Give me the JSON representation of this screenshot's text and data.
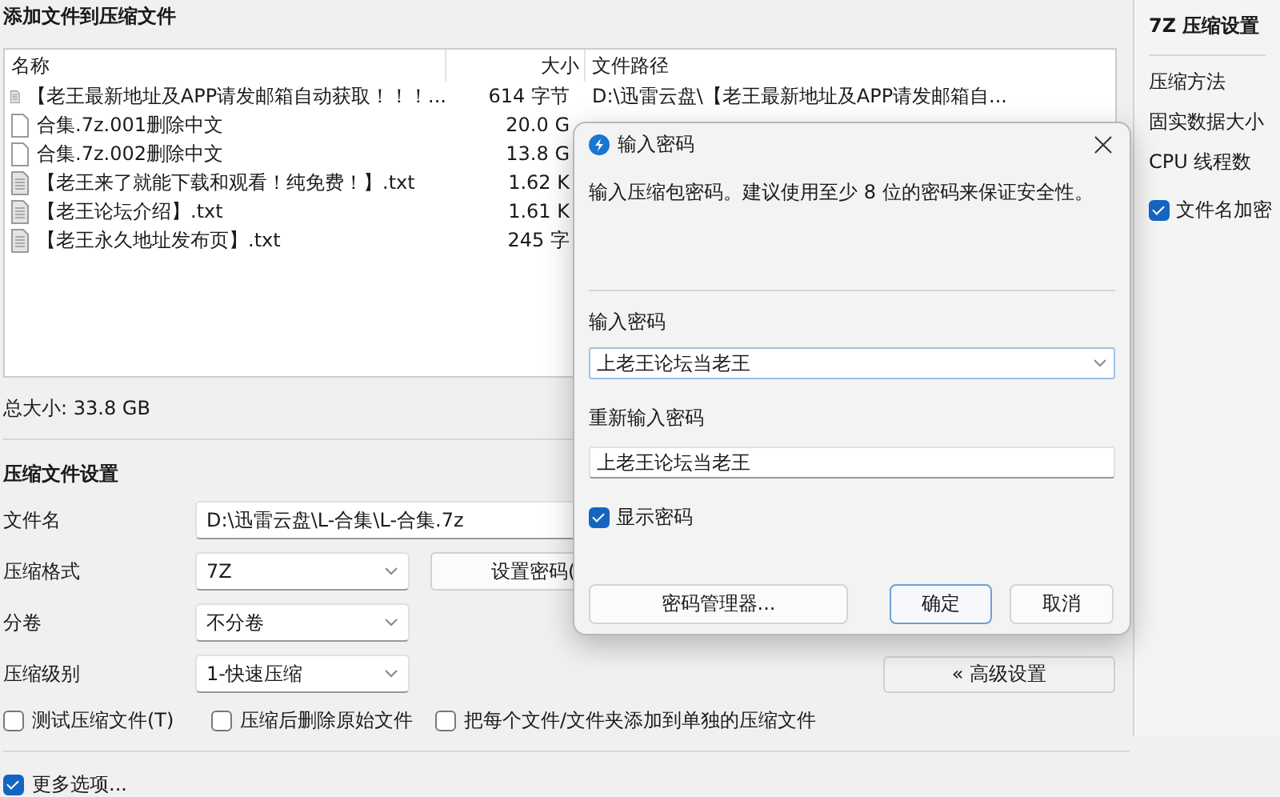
{
  "main": {
    "title": "添加文件到压缩文件",
    "file_list": {
      "columns": [
        "名称",
        "大小",
        "文件路径"
      ],
      "rows": [
        {
          "kind": "text",
          "name": "【老王最新地址及APP请发邮箱自动获取！！！...",
          "size": "614 字节",
          "path": "D:\\迅雷云盘\\【老王最新地址及APP请发邮箱自..."
        },
        {
          "kind": "file",
          "name": "合集.7z.001删除中文",
          "size": "20.0 G"
        },
        {
          "kind": "file",
          "name": "合集.7z.002删除中文",
          "size": "13.8 G"
        },
        {
          "kind": "text",
          "name": "【老王来了就能下载和观看！纯免费！】.txt",
          "size": "1.62 K"
        },
        {
          "kind": "text",
          "name": "【老王论坛介绍】.txt",
          "size": "1.61 K"
        },
        {
          "kind": "text",
          "name": "【老王永久地址发布页】.txt",
          "size": "245 字"
        }
      ]
    },
    "total_size": "总大小: 33.8 GB",
    "settings": {
      "title": "压缩文件设置",
      "filename": {
        "label": "文件名",
        "value": "D:\\迅雷云盘\\L-合集\\L-合集.7z"
      },
      "format": {
        "label": "压缩格式",
        "value": "7Z"
      },
      "set_password_button": "设置密码(",
      "volume": {
        "label": "分卷",
        "value": "不分卷"
      },
      "level": {
        "label": "压缩级别",
        "value": "1-快速压缩"
      },
      "advanced_button": "« 高级设置",
      "options": [
        {
          "label": "测试压缩文件(T)",
          "checked": false
        },
        {
          "label": "压缩后删除原始文件",
          "checked": false
        },
        {
          "label": "把每个文件/文件夹添加到单独的压缩文件",
          "checked": false
        }
      ]
    },
    "more_options": {
      "label": "更多选项...",
      "checked": true
    }
  },
  "side_panel": {
    "title": "7Z 压缩设置",
    "items": [
      "压缩方法",
      "固实数据大小",
      "CPU 线程数"
    ],
    "encrypt_names": {
      "label": "文件名加密",
      "checked": true
    }
  },
  "dialog": {
    "title": "输入密码",
    "message": "输入压缩包密码。建议使用至少 8 位的密码来保证安全性。",
    "password": {
      "label": "输入密码",
      "value": "上老王论坛当老王"
    },
    "confirm": {
      "label": "重新输入密码",
      "value": "上老王论坛当老王"
    },
    "show_password": {
      "label": "显示密码",
      "checked": true
    },
    "buttons": [
      {
        "label": "密码管理器...",
        "kind": "secondary"
      },
      {
        "label": "确定",
        "kind": "default"
      },
      {
        "label": "取消",
        "kind": "secondary"
      }
    ]
  }
}
